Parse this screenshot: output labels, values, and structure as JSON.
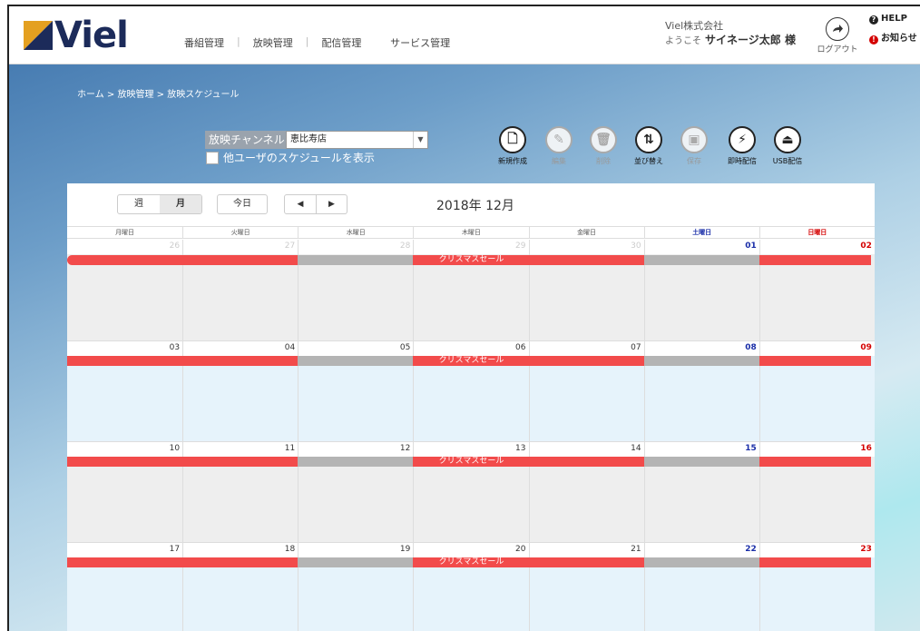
{
  "app": {
    "logo_text": "Viel"
  },
  "nav": [
    {
      "label": "番組管理"
    },
    {
      "label": "放映管理"
    },
    {
      "label": "配信管理"
    },
    {
      "label": "サービス管理"
    }
  ],
  "user": {
    "company": "Viel株式会社",
    "welcome_prefix": "ようこそ",
    "name": "サイネージ太郎 様",
    "logout_label": "ログアウト"
  },
  "help": {
    "help_label": "HELP",
    "notice_label": "お知らせ"
  },
  "breadcrumb": {
    "home": "ホーム",
    "sep": " > ",
    "level2": "放映管理",
    "level3": "放映スケジュール"
  },
  "channel": {
    "label": "放映チャンネル",
    "selected": "恵比寿店"
  },
  "show_others": {
    "label": "他ユーザのスケジュールを表示"
  },
  "toolbar": [
    {
      "label": "新規作成",
      "icon": "document-icon",
      "glyph": "🗋",
      "disabled": false
    },
    {
      "label": "編集",
      "icon": "pencil-icon",
      "glyph": "✎",
      "disabled": true
    },
    {
      "label": "削除",
      "icon": "trash-icon",
      "glyph": "🗑",
      "disabled": true
    },
    {
      "label": "並び替え",
      "icon": "sort-icon",
      "glyph": "⇅",
      "disabled": false
    },
    {
      "label": "保存",
      "icon": "save-icon",
      "glyph": "▣",
      "disabled": true
    },
    {
      "label": "即時配信",
      "icon": "lightning-icon",
      "glyph": "⚡",
      "disabled": false
    },
    {
      "label": "USB配信",
      "icon": "usb-drive-icon",
      "glyph": "⏏",
      "disabled": false
    }
  ],
  "calendar": {
    "view_week": "週",
    "view_month": "月",
    "today": "今日",
    "prev": "◀",
    "next": "▶",
    "month_title": "2018年 12月",
    "weekdays": [
      "月曜日",
      "火曜日",
      "水曜日",
      "木曜日",
      "金曜日",
      "土曜日",
      "日曜日"
    ],
    "weeks": [
      {
        "days": [
          "26",
          "27",
          "28",
          "29",
          "30",
          "01",
          "02"
        ],
        "other_month": [
          true,
          true,
          true,
          true,
          true,
          false,
          false
        ],
        "shade": "gray"
      },
      {
        "days": [
          "03",
          "04",
          "05",
          "06",
          "07",
          "08",
          "09"
        ],
        "other_month": [
          false,
          false,
          false,
          false,
          false,
          false,
          false
        ],
        "shade": "blue"
      },
      {
        "days": [
          "10",
          "11",
          "12",
          "13",
          "14",
          "15",
          "16"
        ],
        "other_month": [
          false,
          false,
          false,
          false,
          false,
          false,
          false
        ],
        "shade": "gray"
      },
      {
        "days": [
          "17",
          "18",
          "19",
          "20",
          "21",
          "22",
          "23"
        ],
        "other_month": [
          false,
          false,
          false,
          false,
          false,
          false,
          false
        ],
        "shade": "blue"
      }
    ],
    "event": {
      "title": "クリスマスセール",
      "segments": [
        "red",
        "red",
        "gray",
        "red",
        "red",
        "gray",
        "red"
      ]
    }
  },
  "colors": {
    "event_red": "#f24b4b",
    "event_gray": "#b4b4b4",
    "saturday": "#1a2ea8",
    "sunday": "#d40000",
    "shade_gray": "#eeeeee",
    "shade_blue": "#e6f3fb"
  }
}
